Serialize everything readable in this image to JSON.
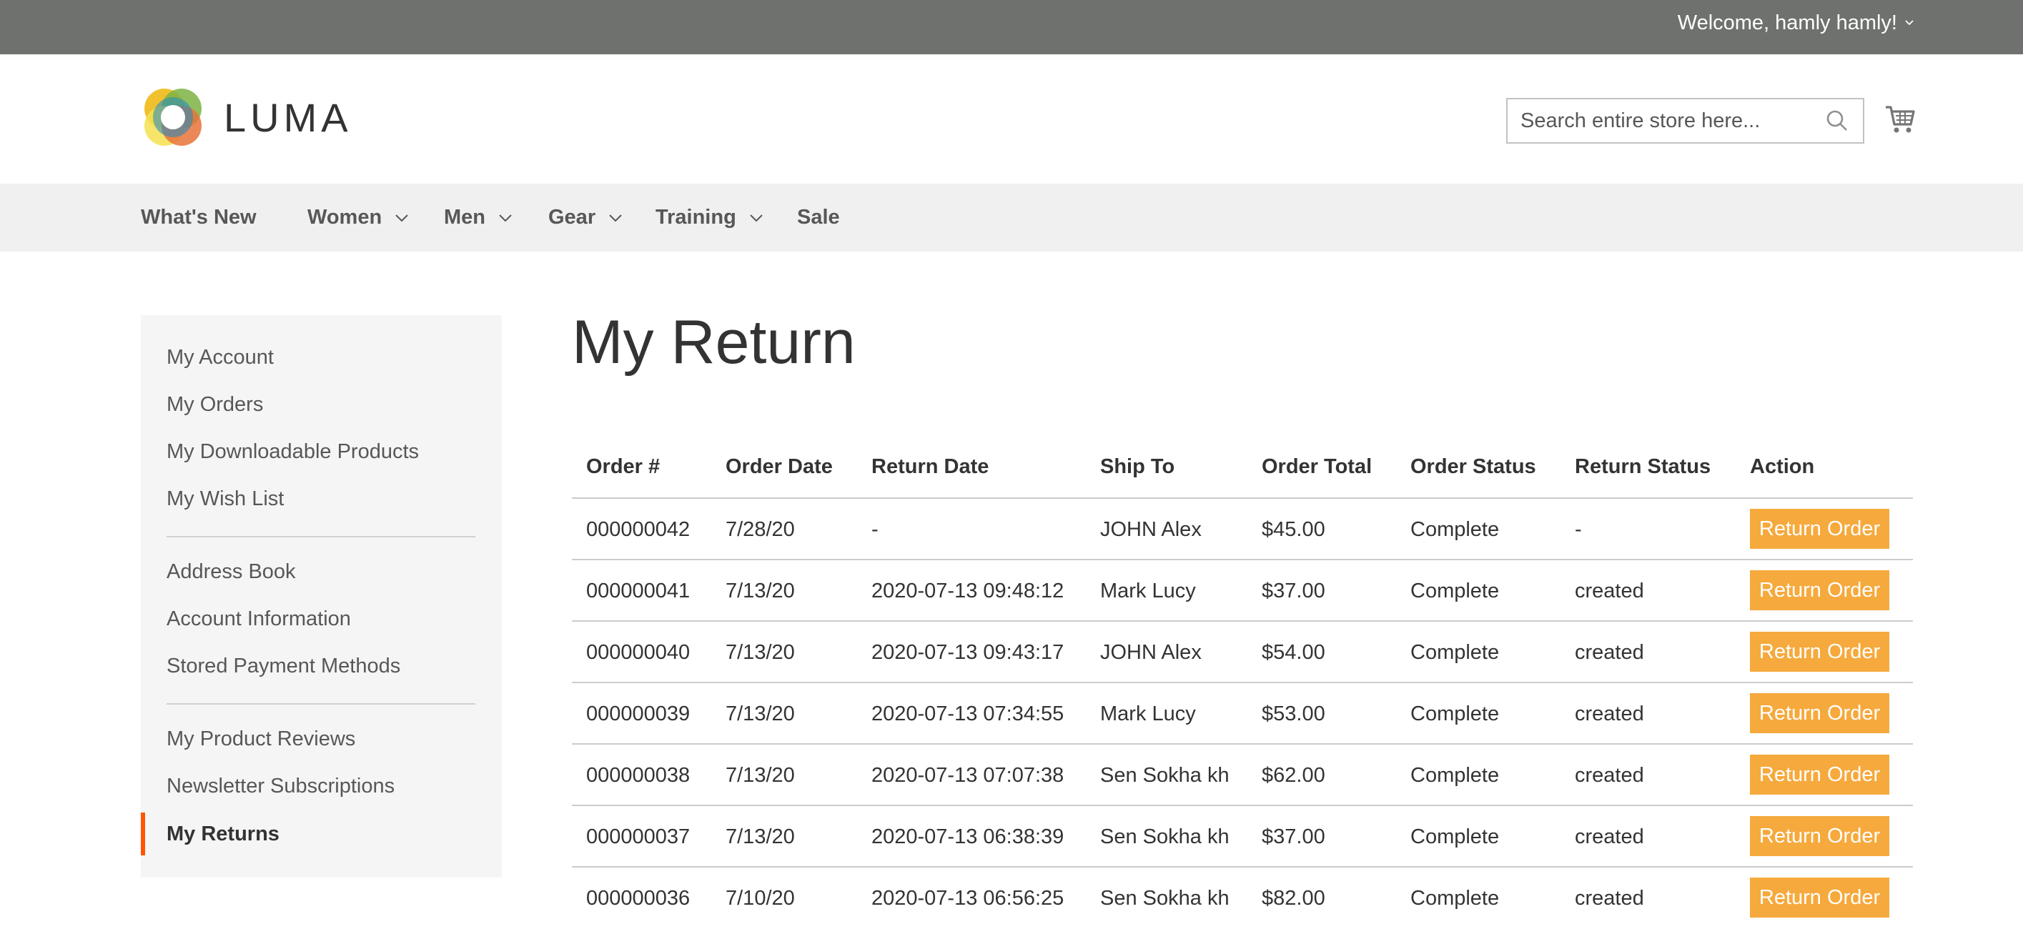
{
  "header": {
    "welcome": "Welcome, hamly hamly!",
    "logo_text": "LUMA",
    "search_placeholder": "Search entire store here..."
  },
  "nav": {
    "items": [
      {
        "label": "What's New",
        "dropdown": false
      },
      {
        "label": "Women",
        "dropdown": true
      },
      {
        "label": "Men",
        "dropdown": true
      },
      {
        "label": "Gear",
        "dropdown": true
      },
      {
        "label": "Training",
        "dropdown": true
      },
      {
        "label": "Sale",
        "dropdown": false
      }
    ]
  },
  "sidebar": {
    "items": [
      {
        "label": "My Account"
      },
      {
        "label": "My Orders"
      },
      {
        "label": "My Downloadable Products"
      },
      {
        "label": "My Wish List"
      },
      {
        "label": "Address Book"
      },
      {
        "label": "Account Information"
      },
      {
        "label": "Stored Payment Methods"
      },
      {
        "label": "My Product Reviews"
      },
      {
        "label": "Newsletter Subscriptions"
      },
      {
        "label": "My Returns",
        "active": true
      }
    ]
  },
  "main": {
    "title": "My Return",
    "columns": [
      "Order #",
      "Order Date",
      "Return Date",
      "Ship To",
      "Order Total",
      "Order Status",
      "Return Status",
      "Action"
    ],
    "rows": [
      {
        "order": "000000042",
        "order_date": "7/28/20",
        "return_date": "-",
        "ship_to": "JOHN Alex",
        "total": "$45.00",
        "order_status": "Complete",
        "return_status": "-",
        "action": "Return Order"
      },
      {
        "order": "000000041",
        "order_date": "7/13/20",
        "return_date": "2020-07-13 09:48:12",
        "ship_to": "Mark Lucy",
        "total": "$37.00",
        "order_status": "Complete",
        "return_status": "created",
        "action": "Return Order"
      },
      {
        "order": "000000040",
        "order_date": "7/13/20",
        "return_date": "2020-07-13 09:43:17",
        "ship_to": "JOHN Alex",
        "total": "$54.00",
        "order_status": "Complete",
        "return_status": "created",
        "action": "Return Order"
      },
      {
        "order": "000000039",
        "order_date": "7/13/20",
        "return_date": "2020-07-13 07:34:55",
        "ship_to": "Mark Lucy",
        "total": "$53.00",
        "order_status": "Complete",
        "return_status": "created",
        "action": "Return Order"
      },
      {
        "order": "000000038",
        "order_date": "7/13/20",
        "return_date": "2020-07-13 07:07:38",
        "ship_to": "Sen Sokha kh",
        "total": "$62.00",
        "order_status": "Complete",
        "return_status": "created",
        "action": "Return Order"
      },
      {
        "order": "000000037",
        "order_date": "7/13/20",
        "return_date": "2020-07-13 06:38:39",
        "ship_to": "Sen Sokha kh",
        "total": "$37.00",
        "order_status": "Complete",
        "return_status": "created",
        "action": "Return Order"
      },
      {
        "order": "000000036",
        "order_date": "7/10/20",
        "return_date": "2020-07-13 06:56:25",
        "ship_to": "Sen Sokha kh",
        "total": "$82.00",
        "order_status": "Complete",
        "return_status": "created",
        "action": "Return Order"
      }
    ]
  },
  "colors": {
    "topbar": "#6e716e",
    "nav_bg": "#f0f0f0",
    "sidebar_bg": "#f5f5f5",
    "active_marker": "#ff5501",
    "action_button": "#f6a93c"
  }
}
